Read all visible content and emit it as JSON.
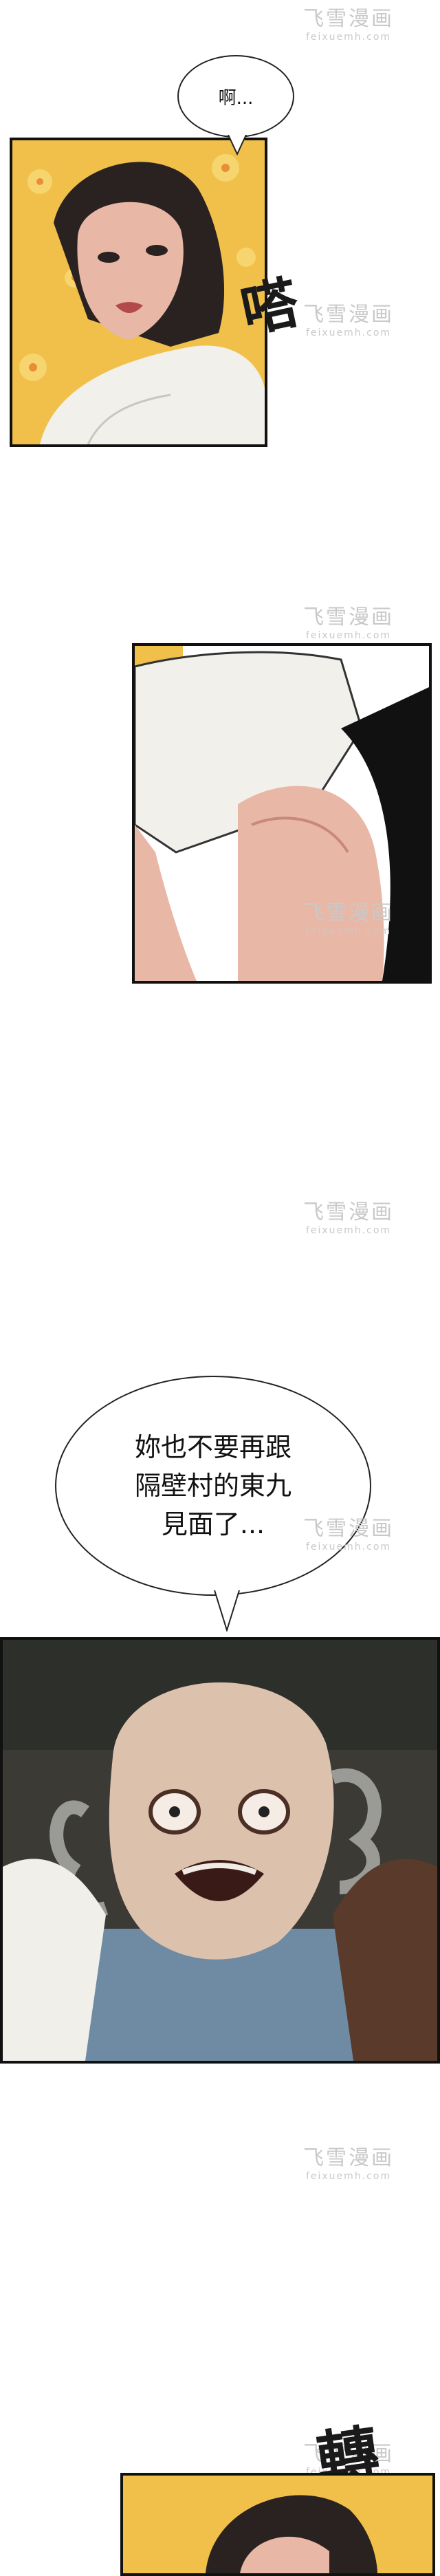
{
  "bubbles": {
    "b1": "啊...",
    "b2": "妳也不要再跟\n隔壁村的東九\n見面了..."
  },
  "sfx": {
    "s1": "嗒",
    "s2": "轉"
  },
  "watermark": {
    "title": "飞雪漫画",
    "url": "feixuemh.com"
  },
  "colors": {
    "flower_bg": "#f1c04a",
    "skin": "#e8b7a6",
    "hair": "#2a2220",
    "shirt": "#f2f0ea",
    "bed": "#6f8ba3"
  }
}
